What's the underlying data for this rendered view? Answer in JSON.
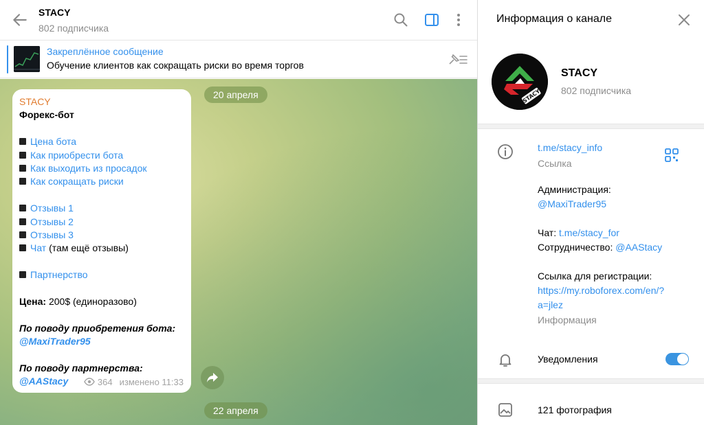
{
  "header": {
    "title": "STACY",
    "subtitle": "802 подписчика"
  },
  "pinned": {
    "title": "Закреплённое сообщение",
    "text": "Обучение клиентов как сокращать риски во время торгов"
  },
  "dates": [
    "20 апреля",
    "22 апреля"
  ],
  "message": {
    "author": "STACY",
    "heading": "Форекс-бот",
    "menu1": [
      "Цена бота",
      "Как приобрести бота",
      "Как выходить из просадок",
      "Как сокращать риски"
    ],
    "reviews": [
      "Отзывы 1",
      "Отзывы 2",
      "Отзывы 3"
    ],
    "chat_link": "Чат",
    "chat_note": " (там ещё отзывы)",
    "partner": "Партнерство",
    "price_label": "Цена:",
    "price_value": " 200$ (единоразово)",
    "buy_label": "По поводу приобретения бота:",
    "buy_contact": "@MaxiTrader95",
    "partner_label": "По поводу партнерства:",
    "partner_contact": "@AAStacy",
    "views": "364",
    "edited": "изменено 11:33"
  },
  "info": {
    "title": "Информация о канале",
    "name": "STACY",
    "subs": "802 подписчика",
    "link": "t.me/stacy_info",
    "link_caption": "Ссылка",
    "admin_label": "Администрация:",
    "admin_contact": "@MaxiTrader95",
    "chat_label": "Чат: ",
    "chat_link": "t.me/stacy_for",
    "coop_label": "Сотрудничество: ",
    "coop_contact": "@AAStacy",
    "reg_label": "Ссылка для регистрации:",
    "reg_link_1": "https://my.roboforex.com/en/?",
    "reg_link_2": "a=jlez",
    "desc_caption": "Информация",
    "notifications": "Уведомления",
    "notifications_on": true,
    "photos": "121 фотография"
  },
  "colors": {
    "accent": "#3390ec",
    "author": "#e17c2f",
    "toggle": "#3a94e0"
  }
}
